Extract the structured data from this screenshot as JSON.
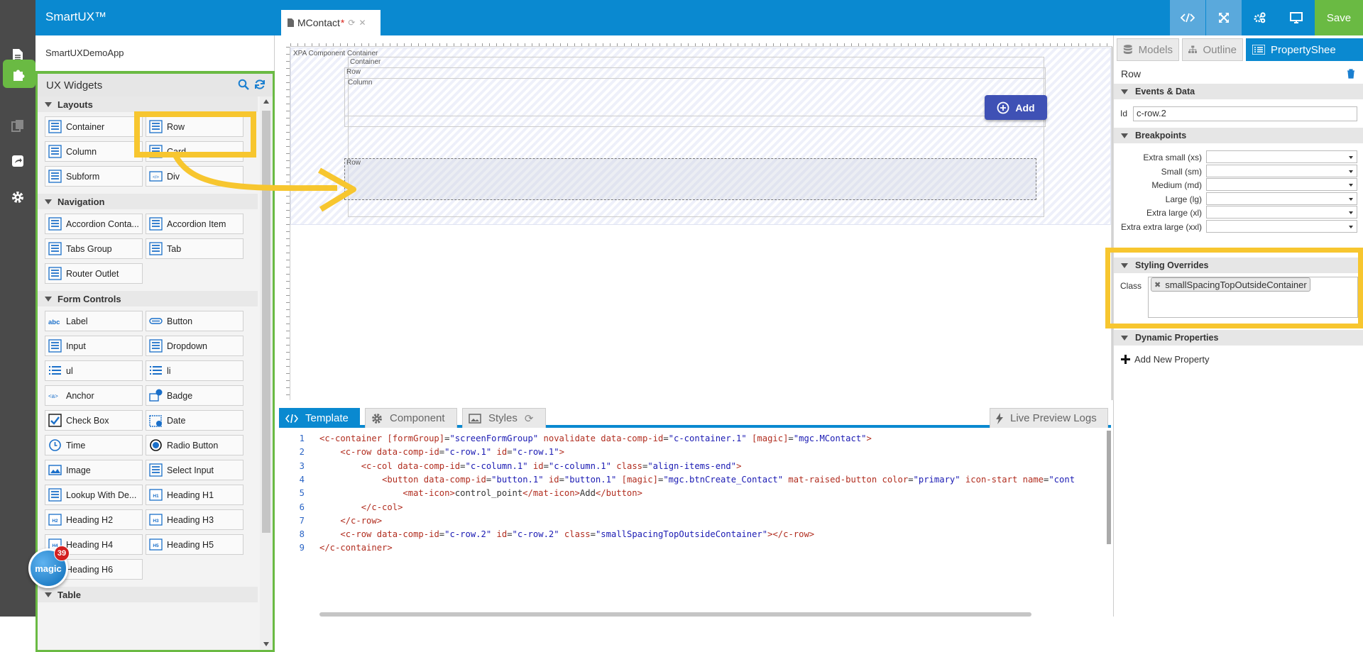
{
  "app": {
    "brand": "SmartUX™",
    "project": "SmartUXDemoApp",
    "save_label": "Save"
  },
  "doc_tab": {
    "title": "MContact",
    "dirty_marker": "*"
  },
  "colors": {
    "topbar": "#0a89d0",
    "accent_green": "#6aba43",
    "highlight": "#f7c62f",
    "primary_button": "#3f51b5"
  },
  "widgets": {
    "title": "UX Widgets",
    "sections": [
      {
        "name": "Layouts",
        "items": [
          {
            "label": "Container",
            "icon": "container-icon"
          },
          {
            "label": "Row",
            "icon": "row-icon"
          },
          {
            "label": "Column",
            "icon": "column-icon"
          },
          {
            "label": "Card",
            "icon": "card-icon"
          },
          {
            "label": "Subform",
            "icon": "subform-icon"
          },
          {
            "label": "Div",
            "icon": "div-icon"
          }
        ]
      },
      {
        "name": "Navigation",
        "items": [
          {
            "label": "Accordion Conta...",
            "icon": "accordion-container-icon"
          },
          {
            "label": "Accordion Item",
            "icon": "accordion-item-icon"
          },
          {
            "label": "Tabs Group",
            "icon": "tabs-group-icon"
          },
          {
            "label": "Tab",
            "icon": "tab-icon"
          },
          {
            "label": "Router Outlet",
            "icon": "router-outlet-icon"
          }
        ]
      },
      {
        "name": "Form Controls",
        "items": [
          {
            "label": "Label",
            "icon": "label-icon"
          },
          {
            "label": "Button",
            "icon": "button-icon"
          },
          {
            "label": "Input",
            "icon": "input-icon"
          },
          {
            "label": "Dropdown",
            "icon": "dropdown-icon"
          },
          {
            "label": "ul",
            "icon": "ul-icon"
          },
          {
            "label": "li",
            "icon": "li-icon"
          },
          {
            "label": "Anchor",
            "icon": "anchor-icon"
          },
          {
            "label": "Badge",
            "icon": "badge-icon"
          },
          {
            "label": "Check Box",
            "icon": "checkbox-icon"
          },
          {
            "label": "Date",
            "icon": "date-icon"
          },
          {
            "label": "Time",
            "icon": "time-icon"
          },
          {
            "label": "Radio Button",
            "icon": "radio-button-icon"
          },
          {
            "label": "Image",
            "icon": "image-icon"
          },
          {
            "label": "Select Input",
            "icon": "select-input-icon"
          },
          {
            "label": "Lookup With De...",
            "icon": "lookup-icon"
          },
          {
            "label": "Heading H1",
            "icon": "heading-h1-icon"
          },
          {
            "label": "Heading H2",
            "icon": "heading-h2-icon"
          },
          {
            "label": "Heading H3",
            "icon": "heading-h3-icon"
          },
          {
            "label": "Heading H4",
            "icon": "heading-h4-icon"
          },
          {
            "label": "Heading H5",
            "icon": "heading-h5-icon"
          },
          {
            "label": "Heading H6",
            "icon": "heading-h6-icon"
          }
        ]
      },
      {
        "name": "Table",
        "items": []
      }
    ]
  },
  "canvas": {
    "root_label": "XPA Component Container",
    "container_label": "Container",
    "row_label": "Row",
    "column_label": "Column",
    "row2_label": "Row",
    "add_button_label": "Add"
  },
  "editor": {
    "tabs": [
      {
        "label": "Template",
        "icon": "code-icon"
      },
      {
        "label": "Component",
        "icon": "gear-icon"
      },
      {
        "label": "Styles",
        "icon": "image-icon"
      }
    ],
    "logs_label": "Live Preview Logs",
    "line_numbers": [
      "1",
      "2",
      "3",
      "4",
      "5",
      "6",
      "7",
      "8",
      "9"
    ],
    "lines": [
      [
        [
          "t",
          "<c-container "
        ],
        [
          "a",
          "[formGroup]"
        ],
        [
          "p",
          "="
        ],
        [
          "v",
          "\"screenFormGroup\""
        ],
        [
          "a",
          " novalidate data-comp-id"
        ],
        [
          "p",
          "="
        ],
        [
          "v",
          "\"c-container.1\""
        ],
        [
          "a",
          " [magic]"
        ],
        [
          "p",
          "="
        ],
        [
          "v",
          "\"mgc.MContact\""
        ],
        [
          "t",
          ">"
        ]
      ],
      [
        [
          "p",
          "    "
        ],
        [
          "t",
          "<c-row "
        ],
        [
          "a",
          "data-comp-id"
        ],
        [
          "p",
          "="
        ],
        [
          "v",
          "\"c-row.1\""
        ],
        [
          "a",
          " id"
        ],
        [
          "p",
          "="
        ],
        [
          "v",
          "\"c-row.1\""
        ],
        [
          "t",
          ">"
        ]
      ],
      [
        [
          "p",
          "        "
        ],
        [
          "t",
          "<c-col "
        ],
        [
          "a",
          "data-comp-id"
        ],
        [
          "p",
          "="
        ],
        [
          "v",
          "\"c-column.1\""
        ],
        [
          "a",
          " id"
        ],
        [
          "p",
          "="
        ],
        [
          "v",
          "\"c-column.1\""
        ],
        [
          "a",
          " class"
        ],
        [
          "p",
          "="
        ],
        [
          "v",
          "\"align-items-end\""
        ],
        [
          "t",
          ">"
        ]
      ],
      [
        [
          "p",
          "            "
        ],
        [
          "t",
          "<button "
        ],
        [
          "a",
          "data-comp-id"
        ],
        [
          "p",
          "="
        ],
        [
          "v",
          "\"button.1\""
        ],
        [
          "a",
          " id"
        ],
        [
          "p",
          "="
        ],
        [
          "v",
          "\"button.1\""
        ],
        [
          "a",
          " [magic]"
        ],
        [
          "p",
          "="
        ],
        [
          "v",
          "\"mgc.btnCreate_Contact\""
        ],
        [
          "a",
          " mat-raised-button color"
        ],
        [
          "p",
          "="
        ],
        [
          "v",
          "\"primary\""
        ],
        [
          "a",
          " icon-start name"
        ],
        [
          "p",
          "="
        ],
        [
          "v",
          "\"cont"
        ]
      ],
      [
        [
          "p",
          "                "
        ],
        [
          "t",
          "<mat-icon>"
        ],
        [
          "p",
          "control_point"
        ],
        [
          "t",
          "</mat-icon>"
        ],
        [
          "p",
          "Add"
        ],
        [
          "t",
          "</button>"
        ]
      ],
      [
        [
          "p",
          "        "
        ],
        [
          "t",
          "</c-col>"
        ]
      ],
      [
        [
          "p",
          "    "
        ],
        [
          "t",
          "</c-row>"
        ]
      ],
      [
        [
          "p",
          "    "
        ],
        [
          "t",
          "<c-row "
        ],
        [
          "a",
          "data-comp-id"
        ],
        [
          "p",
          "="
        ],
        [
          "v",
          "\"c-row.2\""
        ],
        [
          "a",
          " id"
        ],
        [
          "p",
          "="
        ],
        [
          "v",
          "\"c-row.2\""
        ],
        [
          "a",
          " class"
        ],
        [
          "p",
          "="
        ],
        [
          "v",
          "\"smallSpacingTopOutsideContainer\""
        ],
        [
          "t",
          "></c-row>"
        ]
      ],
      [
        [
          "t",
          "</c-container>"
        ]
      ]
    ]
  },
  "props": {
    "tabs": [
      {
        "label": "Models",
        "icon": "database-icon"
      },
      {
        "label": "Outline",
        "icon": "sitemap-icon"
      },
      {
        "label": "PropertyShee",
        "icon": "list-icon"
      }
    ],
    "title": "Row",
    "events_section": "Events & Data",
    "id_label": "Id",
    "id_value": "c-row.2",
    "breakpoints_section": "Breakpoints",
    "breakpoints": [
      "Extra small (xs)",
      "Small (sm)",
      "Medium (md)",
      "Large (lg)",
      "Extra large (xl)",
      "Extra extra large (xxl)"
    ],
    "styling_section": "Styling Overrides",
    "class_label": "Class",
    "class_chip": "smallSpacingTopOutsideContainer",
    "dynamic_section": "Dynamic Properties",
    "add_property_label": "Add New Property"
  },
  "magic_badge": {
    "count": "39",
    "label": "magic"
  }
}
